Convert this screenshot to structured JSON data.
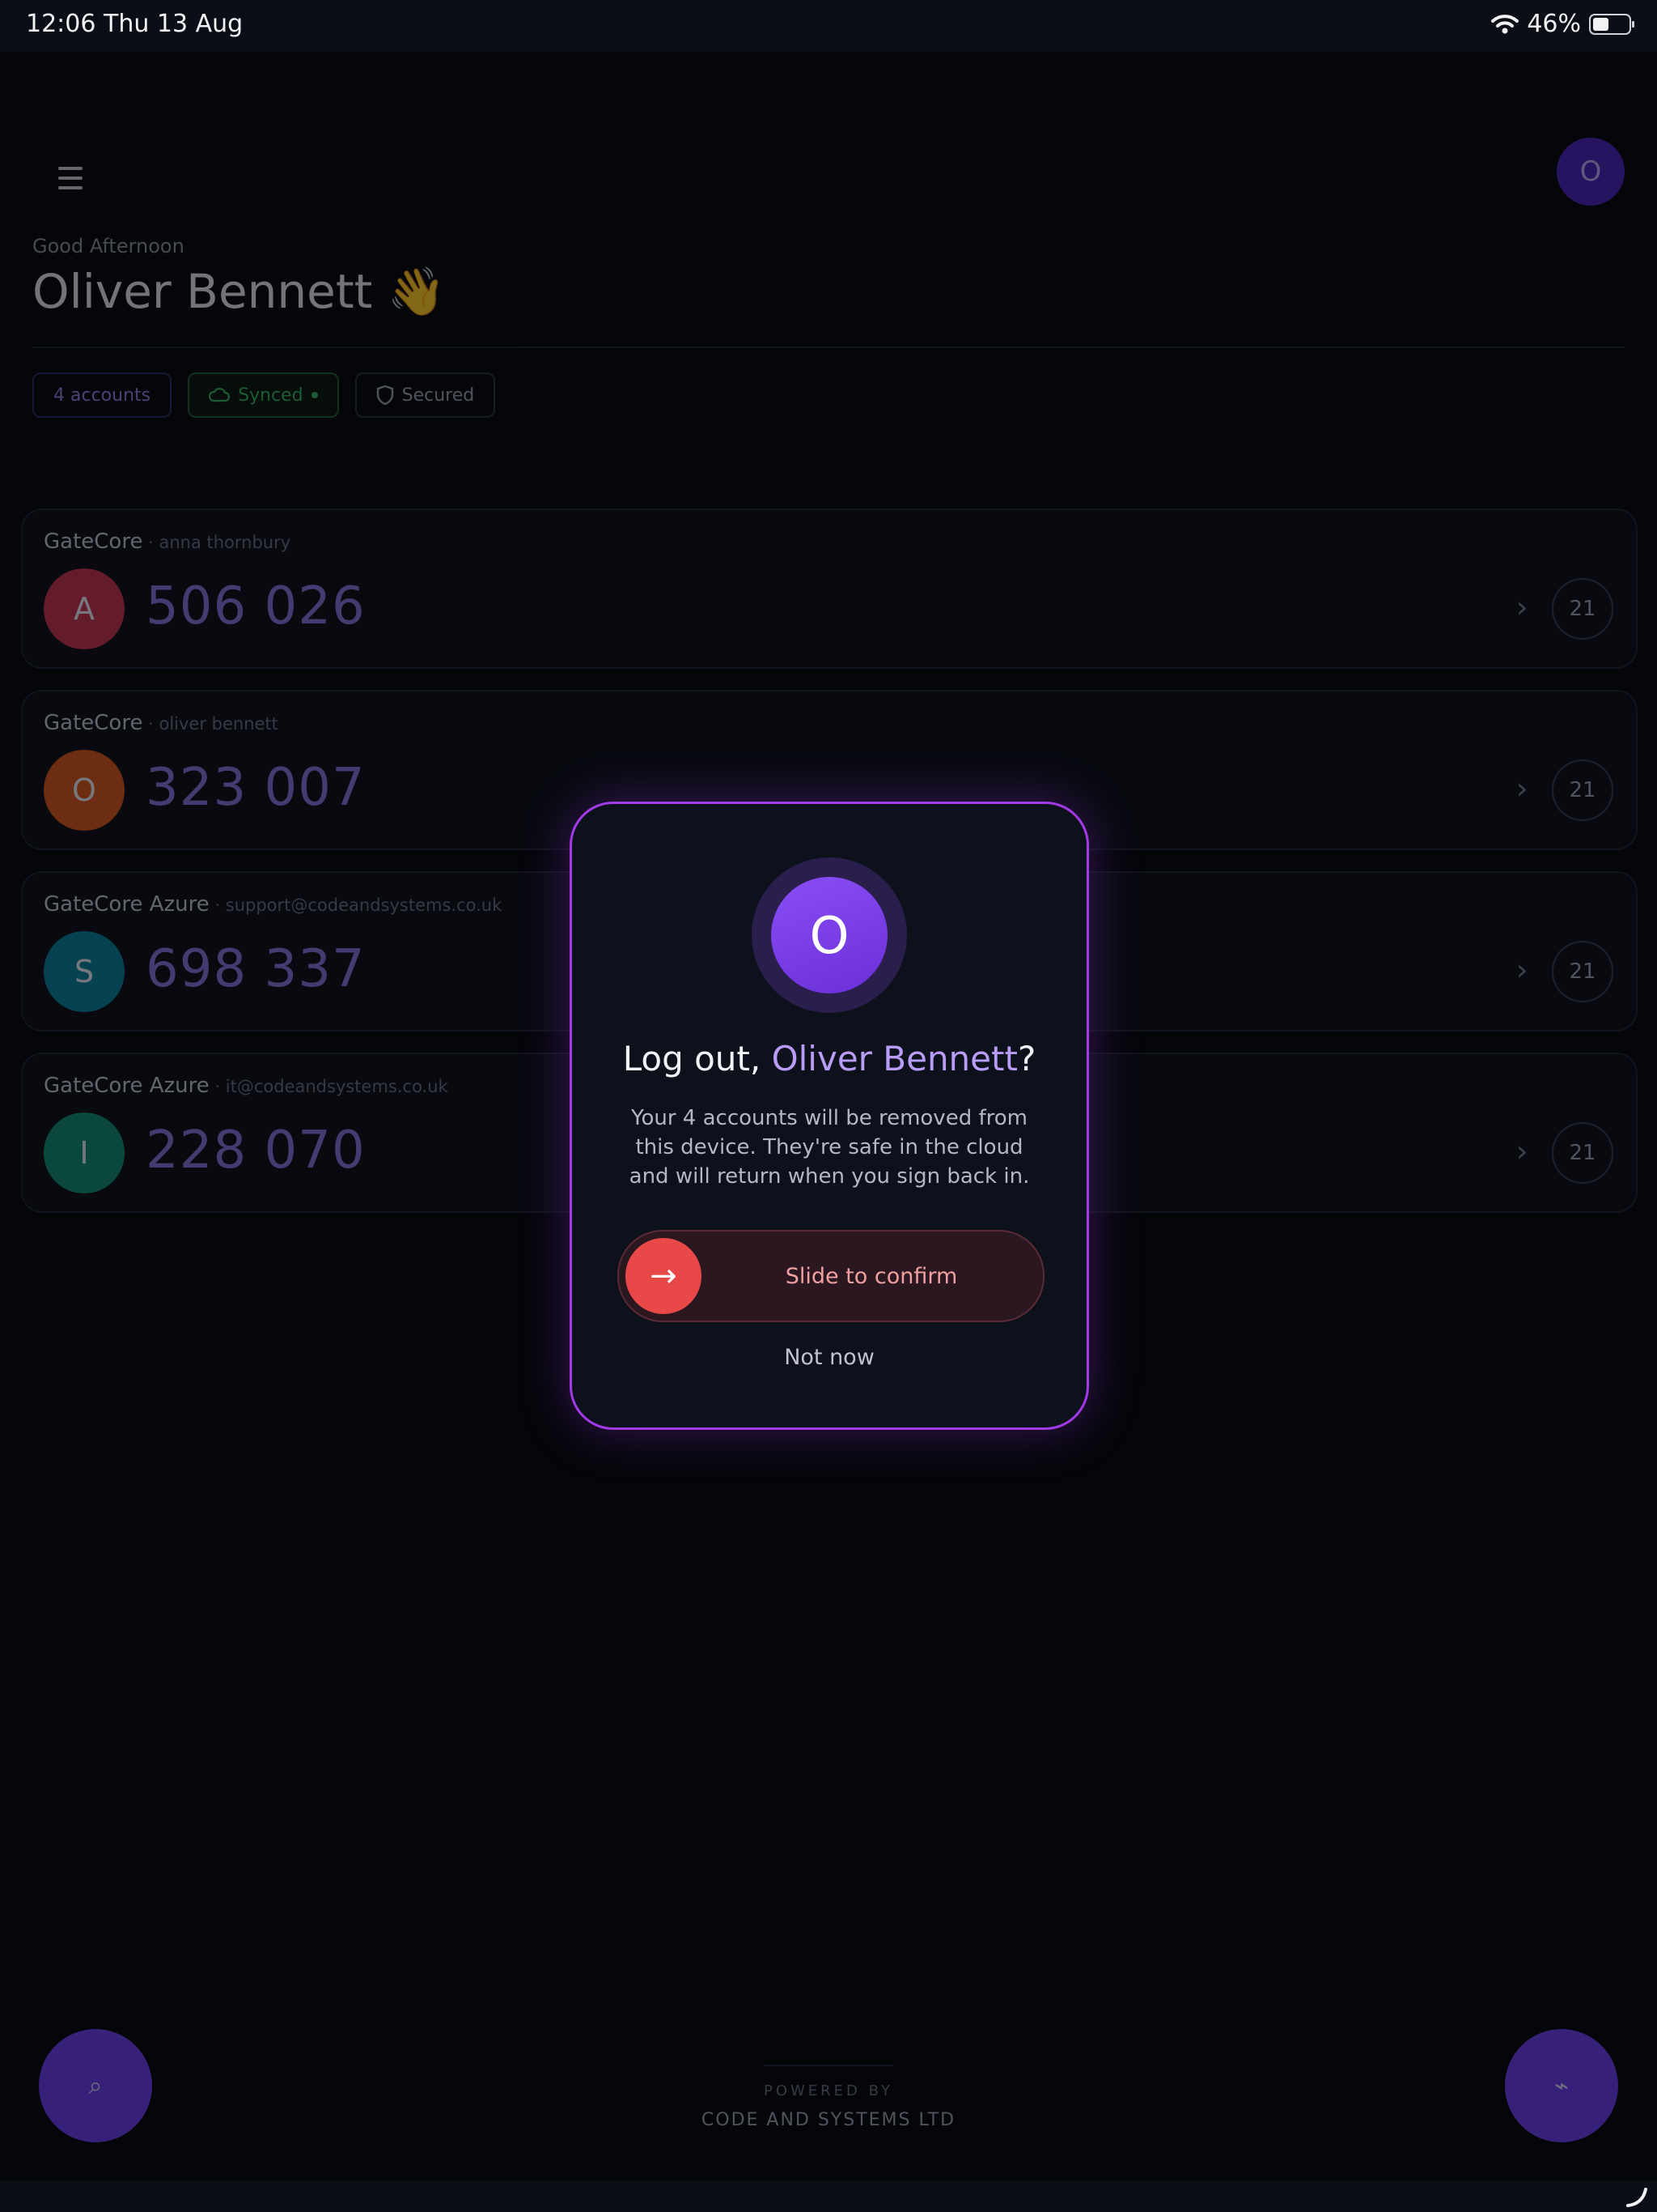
{
  "status_bar": {
    "time": "12:06",
    "date": "Thu 13 Aug",
    "battery": "46%",
    "battery_level": 0.46
  },
  "header": {
    "greeting": "Good Afternoon",
    "user_name": "Oliver Bennett",
    "wave_emoji": "👋",
    "avatar_initial": "O"
  },
  "chips": {
    "accounts": "4 accounts",
    "synced": "Synced",
    "secured": "Secured"
  },
  "accounts": [
    {
      "provider": "GateCore",
      "user": " · anna thornbury",
      "initial": "A",
      "code": "506 026",
      "timer": "21",
      "color": "#c2304f"
    },
    {
      "provider": "GateCore",
      "user": " · oliver bennett",
      "initial": "O",
      "code": "323 007",
      "timer": "21",
      "color": "#d2541a"
    },
    {
      "provider": "GateCore Azure",
      "user": " · support@codeandsystems.co.uk",
      "initial": "S",
      "code": "698 337",
      "timer": "21",
      "color": "#0a7f98"
    },
    {
      "provider": "GateCore Azure",
      "user": " · it@codeandsystems.co.uk",
      "initial": "I",
      "code": "228 070",
      "timer": "21",
      "color": "#0f8a70"
    }
  ],
  "fabs": {
    "left_icon": "⌕",
    "right_icon": "⌁"
  },
  "footer": {
    "powered": "POWERED BY",
    "company": "CODE AND SYSTEMS LTD"
  },
  "modal": {
    "initial": "O",
    "title_prefix": "Log out, ",
    "title_name": "Oliver Bennett",
    "title_suffix": "?",
    "body": "Your 4 accounts will be removed from this device. They're safe in the cloud and will return when you sign back in.",
    "slider_label": "Slide to confirm",
    "slider_arrow": "→",
    "dismiss": "Not now"
  },
  "colors": {
    "accent": "#7c4cf0",
    "danger": "#e84848",
    "modal_border": "#a23ae6",
    "background": "#05060a"
  }
}
